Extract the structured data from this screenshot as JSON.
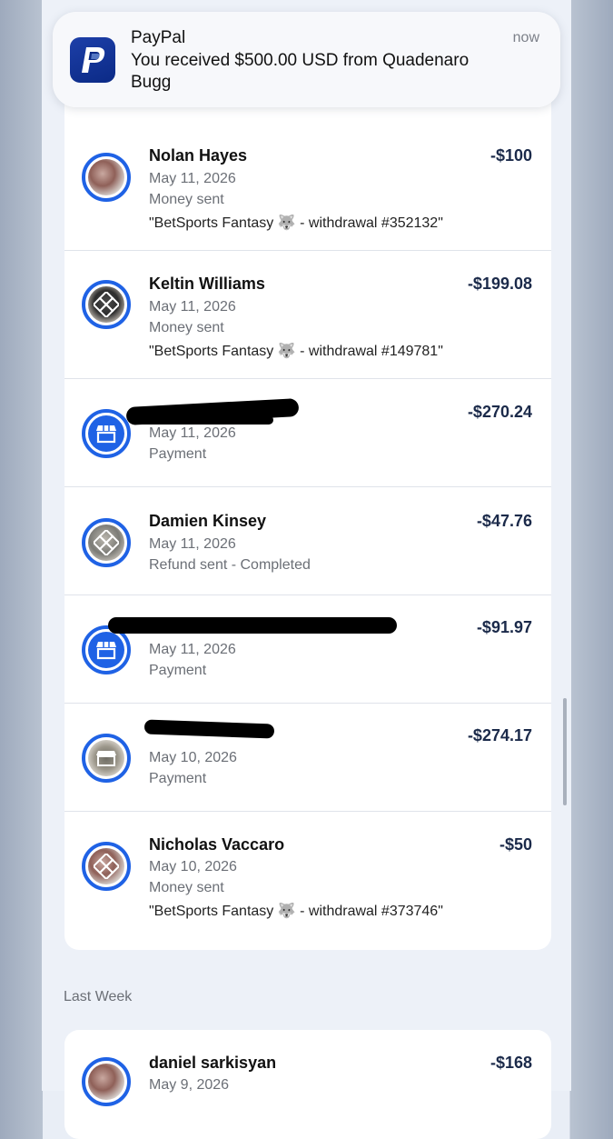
{
  "notification": {
    "app": "PayPal",
    "message": "You received $500.00 USD from Quadenaro Bugg",
    "time": "now",
    "icon": "paypal-logo-icon"
  },
  "transactions": [
    {
      "name": "Nolan Hayes",
      "date": "May 11, 2026",
      "type": "Money sent",
      "note": "\"BetSports Fantasy 🐺 - withdrawal #352132\"",
      "amount": "-$100",
      "avatar": "photo"
    },
    {
      "name": "Keltin Williams",
      "date": "May 11, 2026",
      "type": "Money sent",
      "note": "\"BetSports Fantasy 🐺 - withdrawal #149781\"",
      "amount": "-$199.08",
      "avatar": "photo"
    },
    {
      "name": "",
      "date": "May 11, 2026",
      "type": "Payment",
      "note": "",
      "amount": "-$270.24",
      "avatar": "store-icon"
    },
    {
      "name": "Damien Kinsey",
      "date": "May 11, 2026",
      "type": "Refund sent - Completed",
      "note": "",
      "amount": "-$47.76",
      "avatar": "photo"
    },
    {
      "name": "",
      "date": "May 11, 2026",
      "type": "Payment",
      "note": "",
      "amount": "-$91.97",
      "avatar": "store-icon"
    },
    {
      "name": "",
      "date": "May 10, 2026",
      "type": "Payment",
      "note": "",
      "amount": "-$274.17",
      "avatar": "photo"
    },
    {
      "name": "Nicholas Vaccaro",
      "date": "May 10, 2026",
      "type": "Money sent",
      "note": "\"BetSports Fantasy 🐺 - withdrawal #373746\"",
      "amount": "-$50",
      "avatar": "photo"
    }
  ],
  "section_last_week": "Last Week",
  "last_week": [
    {
      "name": "daniel sarkisyan",
      "date": "May 9, 2026",
      "amount": "-$168",
      "avatar": "photo"
    }
  ],
  "colors": {
    "accent": "#1f62e5",
    "amount": "#1b2a4a",
    "background": "#edf1f8"
  }
}
